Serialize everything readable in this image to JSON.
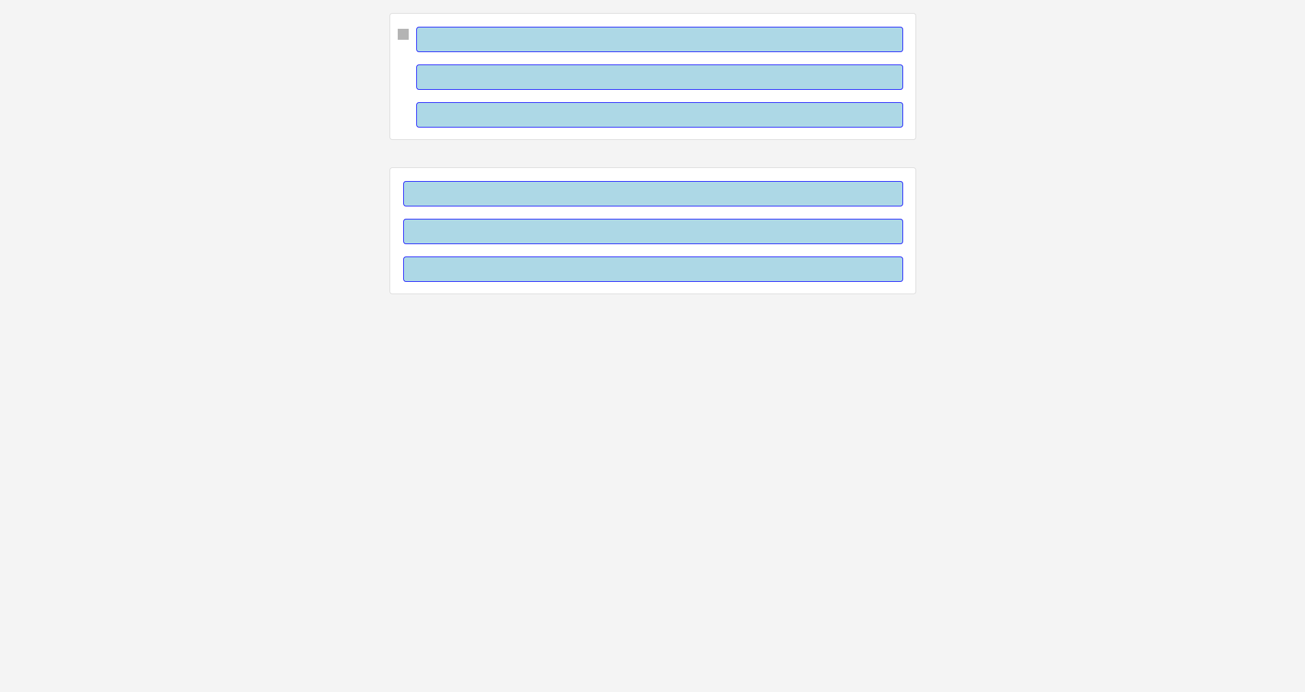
{
  "panels": [
    {
      "handle_icon": "drag-handle-icon",
      "fields": [
        {
          "value": ""
        },
        {
          "value": ""
        },
        {
          "value": ""
        }
      ]
    },
    {
      "fields": [
        {
          "value": ""
        },
        {
          "value": ""
        },
        {
          "value": ""
        }
      ]
    }
  ],
  "colors": {
    "page_background": "#f4f4f4",
    "panel_background": "#ffffff",
    "panel_border": "#dcdcdc",
    "field_fill": "#add8e6",
    "field_border": "#1a1aff",
    "handle": "#b4b4b4"
  }
}
